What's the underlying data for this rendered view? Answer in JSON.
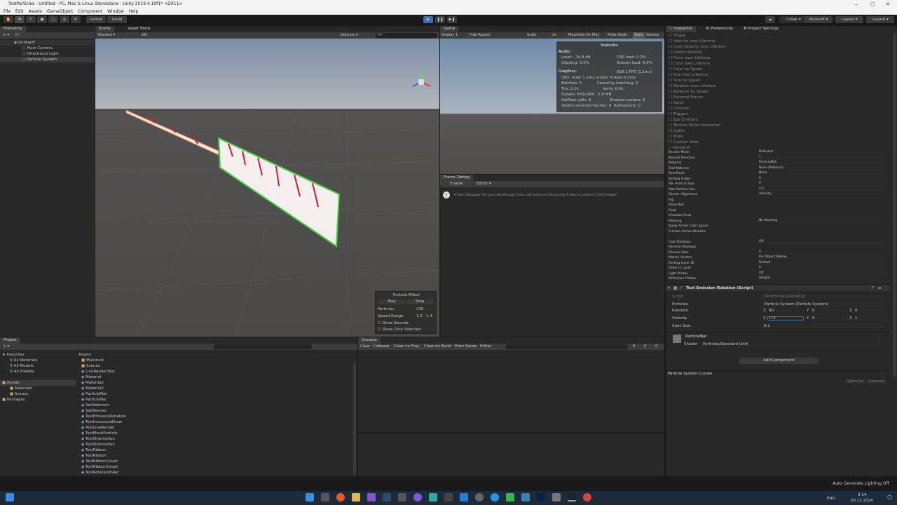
{
  "window": {
    "title": "TestParticles - Untitled - PC, Mac & Linux Standalone - Unity 2019.4.19f1* <DX11>"
  },
  "menu": [
    "File",
    "Edit",
    "Assets",
    "GameObject",
    "Component",
    "Window",
    "Help"
  ],
  "toolbar": {
    "center": "Center",
    "local": "Local",
    "collab": "Collab",
    "account": "Account",
    "layers": "Layers",
    "layout": "Layout"
  },
  "hierarchy": {
    "tab": "Hierarchy",
    "search": "All",
    "scene": "Untitled*",
    "items": [
      "Main Camera",
      "Directional Light",
      "Particle System"
    ]
  },
  "scene": {
    "tabs": [
      "Scene",
      "Asset Store"
    ],
    "shading": "Shaded",
    "mode": "2D",
    "gizmos": "Gizmos",
    "search": "All"
  },
  "particle_effect": {
    "title": "Particle Effect",
    "play": "Play",
    "stop": "Stop",
    "particles_label": "Particles",
    "particles_value": "230",
    "speed_label": "Speed Range",
    "speed_value": "1.0 - 1.4",
    "show_bounds": "Show Bounds",
    "show_only_selected": "Show Only Selected"
  },
  "game": {
    "tab": "Game",
    "display": "Display 1",
    "aspect": "Free Aspect",
    "scale_label": "Scale",
    "scale_value": "1x",
    "maximize": "Maximize On Play",
    "mute": "Mute Audio",
    "stats": "Stats",
    "gizmos": "Gizmos"
  },
  "stats": {
    "title": "Statistics",
    "audio": "Audio:",
    "level": "Level: -74.8 dB",
    "clipping": "Clipping: 0.0%",
    "dsp": "DSP load: 0.2%",
    "stream": "Stream load: 0.0%",
    "graphics": "Graphics:",
    "fps": "928.1 FPS (1.1ms)",
    "cpu": "CPU: main 1.1ms  render thread 0.2ms",
    "batches": "Batches: 5",
    "saved": "Saved by batching: 0",
    "tris": "Tris: 2.1k",
    "verts": "Verts: 6.0k",
    "screen": "Screen: 641x384 - 2.8 MB",
    "setpass": "SetPass calls: 6",
    "shadow": "Shadow casters: 0",
    "skinned": "Visible skinned meshes: 0",
    "animations": "Animations: 0"
  },
  "frame_debug": {
    "tab": "Frame Debug",
    "enable": "Enable",
    "editor": "Editor",
    "info": "Frame Debugger lets you step through draw calls and see how exactly frame is rendered. Click Enable!"
  },
  "project": {
    "tab": "Project",
    "favorites": "Favorites",
    "fav_items": [
      "All Materials",
      "All Models",
      "All Prefabs"
    ],
    "assets": "Assets",
    "asset_tree": [
      "Materials",
      "Scenes"
    ],
    "packages": "Packages",
    "breadcrumb": "Assets",
    "files": [
      "Materials",
      "Scenes",
      "LineRenderTest",
      "Material",
      "Material2",
      "Material3",
      "ParticleMat",
      "ParticleTex",
      "SetMaterials",
      "SetMeshes",
      "TestEmissionRotation",
      "TestInstancedDraw",
      "TestLineRender",
      "TestMeshParticle",
      "TestOrientation",
      "TestOrientation",
      "TestRibbon",
      "TestRibbon",
      "TestRibbonCount",
      "TestRibbonCount",
      "TestRotationEuler"
    ]
  },
  "console": {
    "tab": "Console",
    "buttons": [
      "Clear",
      "Collapse",
      "Clear on Play",
      "Clear on Build",
      "Error Pause",
      "Editor"
    ],
    "counts": [
      "0",
      "0",
      "0"
    ]
  },
  "inspector": {
    "tabs": [
      "Inspector",
      "Preferences",
      "Project Settings"
    ],
    "modules": [
      "Shape",
      "Velocity over Lifetime",
      "Limit Velocity over Lifetime",
      "Inherit Velocity",
      "Force over Lifetime",
      "Color over Lifetime",
      "Color by Speed",
      "Size over Lifetime",
      "Size by Speed",
      "Rotation over Lifetime",
      "Rotation by Speed",
      "External Forces",
      "Noise",
      "Collision",
      "Triggers",
      "Sub Emitters",
      "Texture Sheet Animation",
      "Lights",
      "Trails",
      "Custom Data",
      "Renderer"
    ],
    "renderer_labels": [
      "Render Mode",
      "Normal Direction",
      "Material",
      "Trail Material",
      "Sort Mode",
      "Sorting Fudge",
      "Min Particle Size",
      "Max Particle Size",
      "Render Alignment",
      "Flip",
      "Allow Roll",
      "Pivot",
      "Visualize Pivot",
      "Masking",
      "Apply Active Color Space",
      "Custom Vertex Streams",
      "",
      "Cast Shadows",
      "Receive Shadows",
      "Shadow Bias",
      "Motion Vectors",
      "Sorting Layer ID",
      "Order in Layer",
      "Light Probes",
      "Reflection Probes"
    ],
    "renderer_values": [
      "Billboard",
      "1",
      "ParticleMat",
      "None (Material)",
      "None",
      "0",
      "0",
      "0.5",
      "Velocity",
      "",
      "",
      "",
      "",
      "No Masking",
      "",
      "",
      "",
      "Off",
      "",
      "0",
      "Per Object Motion",
      "Default",
      "0",
      "Off",
      "Simple"
    ],
    "xyz": {
      "x": "X",
      "y": "Y",
      "z": "Z",
      "zero": "0"
    },
    "script": {
      "title": "Test Emission Rotation (Script)",
      "script_label": "Script",
      "script_value": "TestEmissionRotation",
      "particles_label": "Particles",
      "particles_value": "Particle System (Particle System)",
      "rotation_label": "Rotation",
      "rot_x": "90",
      "rot_y": "0",
      "rot_z": "0",
      "velocity_label": "Velocity",
      "vel_x": "0.5",
      "vel_y": "0",
      "vel_z": "1",
      "start_size_label": "Start Size",
      "start_size_value": "0.1"
    },
    "material": {
      "name": "ParticleMat",
      "shader_label": "Shader",
      "shader_value": "Particles/Standard Unlit"
    },
    "add_component": "Add Component",
    "curves": {
      "title": "Particle System Curves",
      "optimize": "Optimize",
      "remove": "Remove"
    }
  },
  "statusbar": "Auto Generate Lighting Off",
  "taskbar": {
    "lang": "ENG",
    "time": "3:14",
    "date": "03.12.2024"
  }
}
